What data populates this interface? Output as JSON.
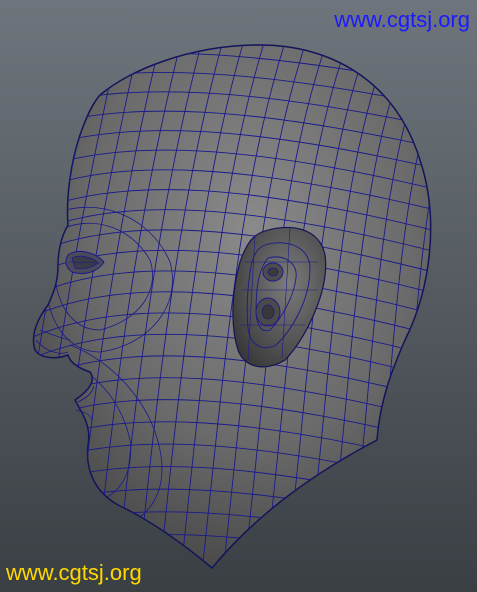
{
  "viewport": {
    "name": "3D viewport",
    "background_top": "#6e757c",
    "background_bottom": "#3a3f44",
    "model": {
      "subject": "head-mesh-side-view",
      "shade_color": "#6a6a6a",
      "wire_color": "#1a1a8c"
    }
  },
  "watermarks": {
    "top_text": "www.cgtsj.org",
    "top_color": "#1a1aff",
    "bottom_text": "www.cgtsj.org",
    "bottom_color": "#ffd800"
  }
}
